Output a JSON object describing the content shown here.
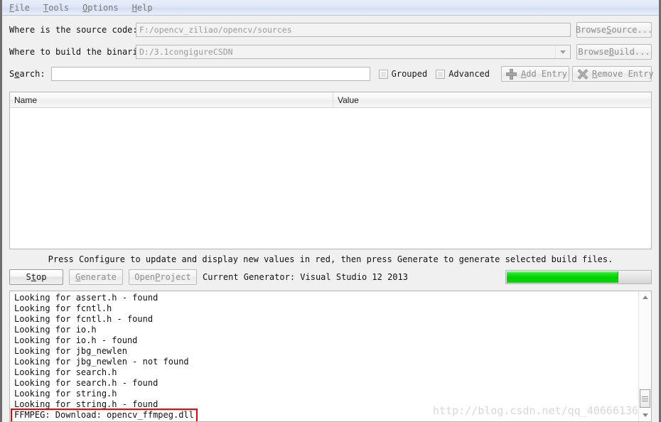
{
  "menu": {
    "items": [
      {
        "pre": "",
        "accel": "F",
        "post": "ile",
        "name": "file"
      },
      {
        "pre": "",
        "accel": "T",
        "post": "ools",
        "name": "tools"
      },
      {
        "pre": "",
        "accel": "O",
        "post": "ptions",
        "name": "options"
      },
      {
        "pre": "",
        "accel": "H",
        "post": "elp",
        "name": "help"
      }
    ]
  },
  "form": {
    "source_label": "Where is the source code:",
    "source_value": "F:/opencv_ziliao/opencv/sources",
    "browse_source": {
      "pre": "Browse ",
      "accel": "S",
      "post": "ource..."
    },
    "build_label": "Where to build the binaries:",
    "build_value": "D:/3.1congigureCSDN",
    "browse_build": {
      "pre": "Browse ",
      "accel": "B",
      "post": "uild..."
    },
    "search_label": {
      "pre": "S",
      "accel": "e",
      "post": "arch:"
    },
    "search_value": "",
    "search_placeholder": ""
  },
  "toolbar": {
    "grouped_label": "Grouped",
    "grouped_checked": false,
    "advanced_label": "Advanced",
    "advanced_checked": false,
    "add_entry": {
      "pre": "",
      "accel": "A",
      "post": "dd Entry"
    },
    "remove_entry": {
      "pre": "",
      "accel": "R",
      "post": "emove Entry"
    }
  },
  "cache": {
    "columns": [
      "Name",
      "Value"
    ],
    "rows": []
  },
  "status": {
    "hint": "Press Configure to update and display new values in red, then press Generate to generate selected build files.",
    "stop_button": {
      "pre": "S",
      "accel": "t",
      "post": "op"
    },
    "generate_button": {
      "pre": "",
      "accel": "G",
      "post": "enerate"
    },
    "open_project_button": {
      "pre": "Open ",
      "accel": "P",
      "post": "roject"
    },
    "generator_text": "Current Generator: Visual Studio 12 2013",
    "progress_percent": 77
  },
  "log": {
    "lines": [
      "Looking for assert.h - found",
      "Looking for fcntl.h",
      "Looking for fcntl.h - found",
      "Looking for io.h",
      "Looking for io.h - found",
      "Looking for jbg_newlen",
      "Looking for jbg_newlen - not found",
      "Looking for search.h",
      "Looking for search.h - found",
      "Looking for string.h",
      "Looking for string.h - found"
    ],
    "highlighted_line": "FFMPEG: Download: opencv_ffmpeg.dll",
    "highlight_color": "#ee0000"
  },
  "watermark": "http://blog.csdn.net/qq_40666136"
}
